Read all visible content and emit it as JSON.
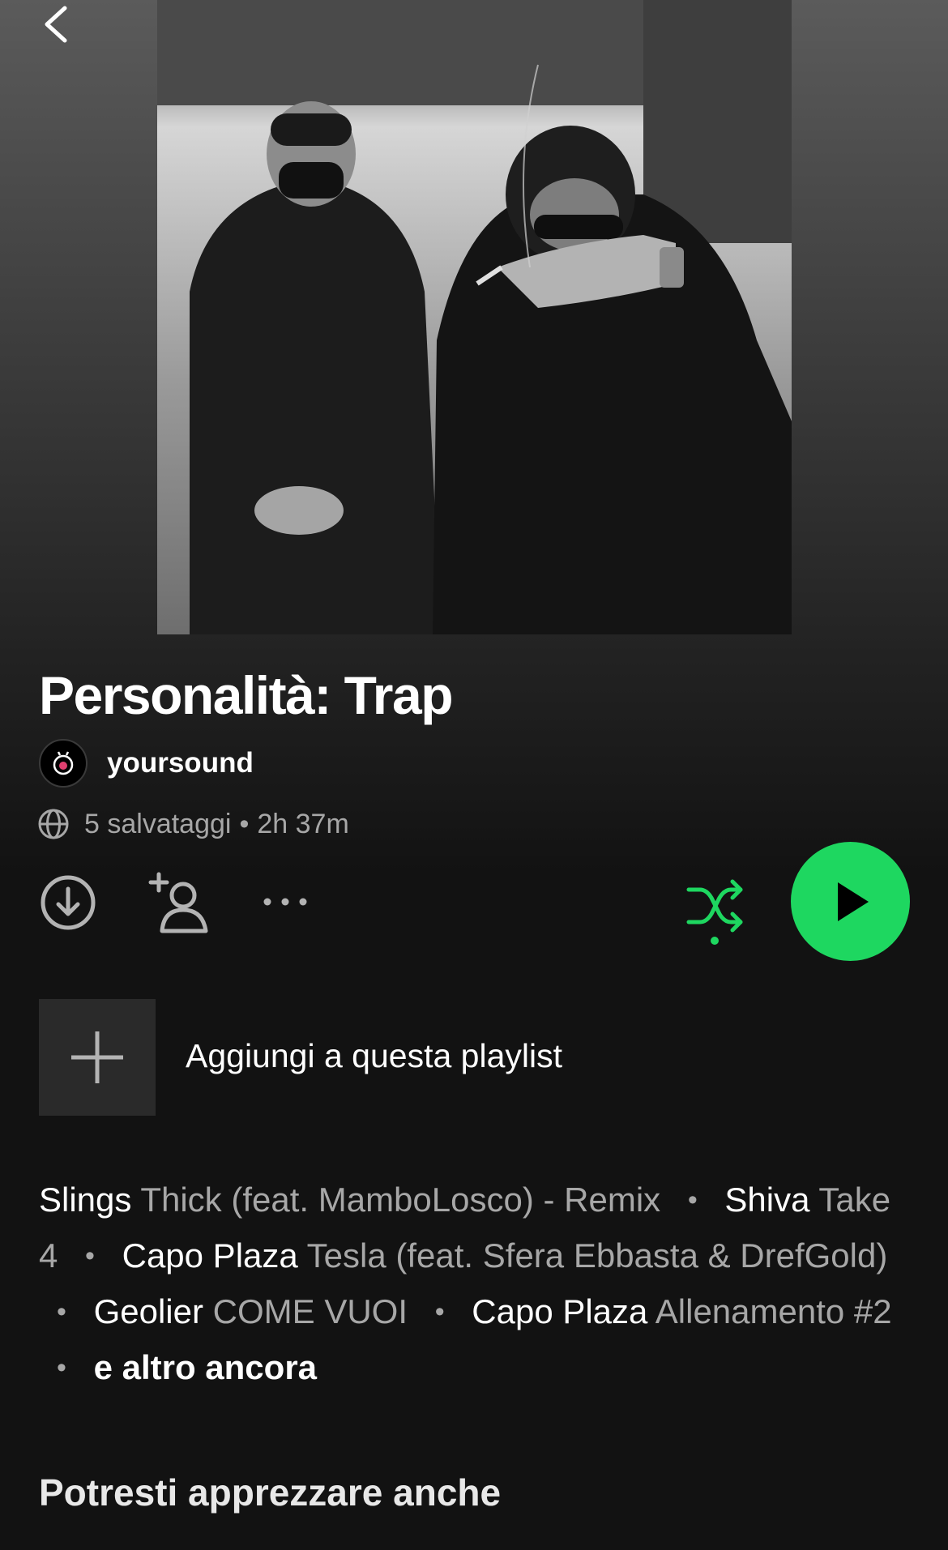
{
  "colors": {
    "background": "#121212",
    "accent": "#1ed760",
    "secondary_text": "#a7a7a7"
  },
  "header": {
    "back_icon": "chevron-left-icon"
  },
  "playlist": {
    "title": "Personalità: Trap",
    "owner": "yoursound",
    "saves": "5 salvataggi",
    "separator": "•",
    "duration": "2h 37m"
  },
  "actions": {
    "download_icon": "download-icon",
    "add_user_icon": "add-user-icon",
    "more_icon": "more-icon",
    "shuffle_icon": "shuffle-icon",
    "play_icon": "play-icon"
  },
  "add_to_playlist": {
    "label": "Aggiungi a questa playlist",
    "icon": "plus-icon"
  },
  "tracks": [
    {
      "artist": "Slings",
      "title": "Thick (feat. MamboLosco) - Remix"
    },
    {
      "artist": "Shiva",
      "title": "Take 4"
    },
    {
      "artist": "Capo Plaza",
      "title": "Tesla (feat. Sfera Ebbasta & DrefGold)"
    },
    {
      "artist": "Geolier",
      "title": "COME VUOI"
    },
    {
      "artist": "Capo Plaza",
      "title": "Allenamento #2"
    }
  ],
  "tracks_more": "e altro ancora",
  "recommendations": {
    "title": "Potresti apprezzare anche"
  }
}
